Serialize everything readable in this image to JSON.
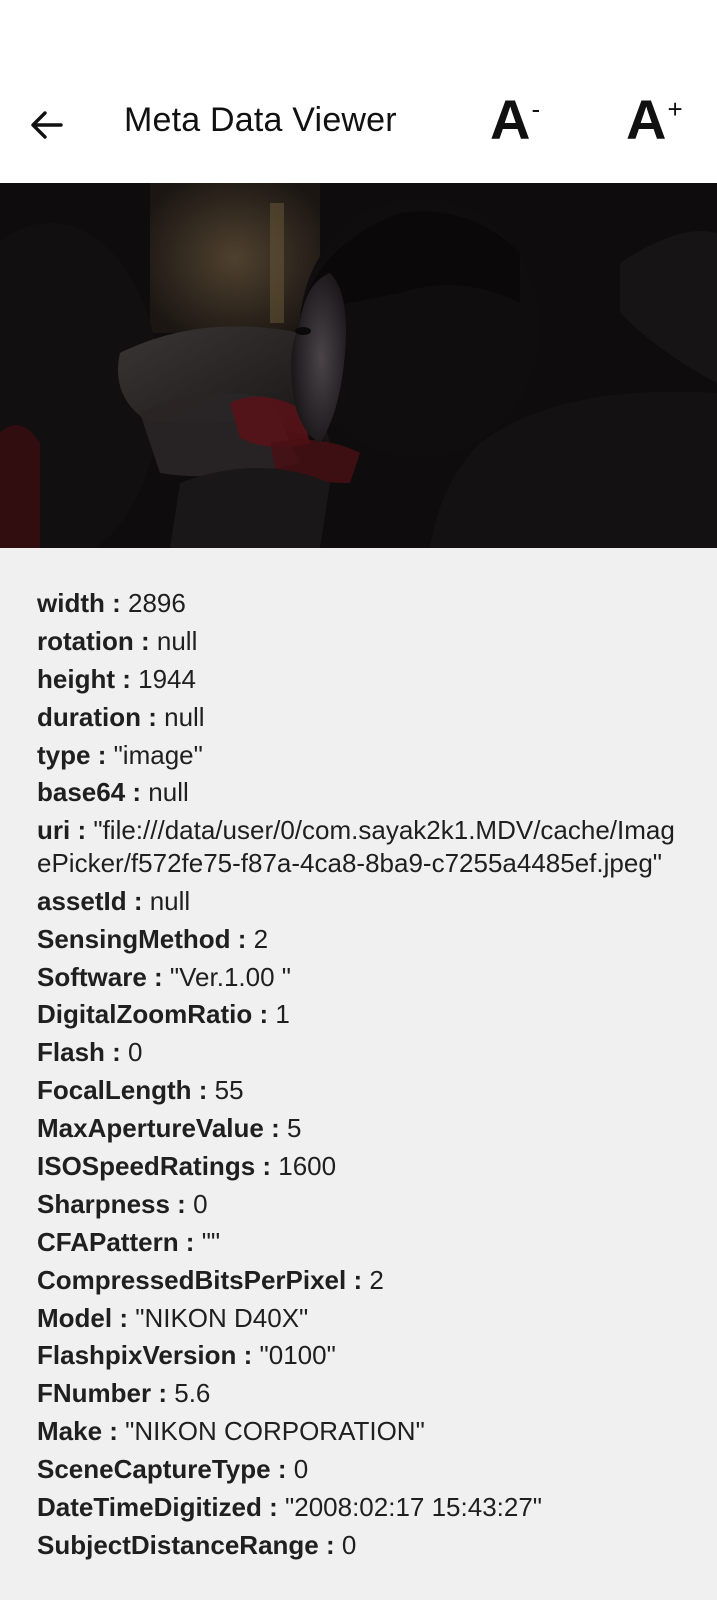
{
  "app_bar": {
    "title": "Meta Data Viewer",
    "back_icon": "arrow-left-icon",
    "font_decrease": {
      "letter": "A",
      "modifier": "-"
    },
    "font_increase": {
      "letter": "A",
      "modifier": "+"
    }
  },
  "photo": {
    "description_icon": "photo"
  },
  "separator": " : ",
  "metadata": [
    {
      "key": "width",
      "value": "2896"
    },
    {
      "key": "rotation",
      "value": "null"
    },
    {
      "key": "height",
      "value": "1944"
    },
    {
      "key": "duration",
      "value": "null"
    },
    {
      "key": "type",
      "value": "\"image\""
    },
    {
      "key": "base64",
      "value": "null"
    },
    {
      "key": "uri",
      "value": "\"file:///data/user/0/com.sayak2k1.MDV/cache/ImagePicker/f572fe75-f87a-4ca8-8ba9-c7255a4485ef.jpeg\""
    },
    {
      "key": "assetId",
      "value": "null"
    },
    {
      "key": "SensingMethod",
      "value": "2"
    },
    {
      "key": "Software",
      "value": "\"Ver.1.00 \""
    },
    {
      "key": "DigitalZoomRatio",
      "value": "1"
    },
    {
      "key": "Flash",
      "value": "0"
    },
    {
      "key": "FocalLength",
      "value": "55"
    },
    {
      "key": "MaxApertureValue",
      "value": "5"
    },
    {
      "key": "ISOSpeedRatings",
      "value": "1600"
    },
    {
      "key": "Sharpness",
      "value": "0"
    },
    {
      "key": "CFAPattern",
      "value": "\"\""
    },
    {
      "key": "CompressedBitsPerPixel",
      "value": "2"
    },
    {
      "key": "Model",
      "value": "\"NIKON D40X\""
    },
    {
      "key": "FlashpixVersion",
      "value": "\"0100\""
    },
    {
      "key": "FNumber",
      "value": "5.6"
    },
    {
      "key": "Make",
      "value": "\"NIKON CORPORATION\""
    },
    {
      "key": "SceneCaptureType",
      "value": "0"
    },
    {
      "key": "DateTimeDigitized",
      "value": "\"2008:02:17 15:43:27\""
    },
    {
      "key": "SubjectDistanceRange",
      "value": "0"
    }
  ]
}
